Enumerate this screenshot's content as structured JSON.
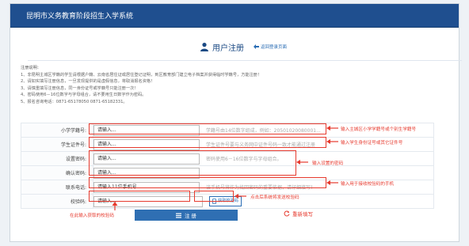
{
  "header": {
    "title": "昆明市义务教育阶段招生入学系统"
  },
  "register": {
    "title": "用户注册",
    "back_link": "返回登录页面"
  },
  "notes": {
    "heading": "注册说明：",
    "lines": [
      "1、非昆明主城区学籍的学生请根据户籍、云南省居住证或居住登记证明，到区教育部门建立电子档案并获得临时学籍号，方能注册！",
      "2、请如实填写注册信息，一旦发现提供的是虚假信息，将取消报名资格！",
      "3、请慎重填写注册信息，同一身份证号或学籍号只能注册一次！",
      "4、密码使用6－16位数字与字母组合，请不要用生日数字作为密码。",
      "5、报名咨询电话：0871-65178050 0871-65182331。"
    ]
  },
  "form": {
    "rows": [
      {
        "label": "小学学籍号:",
        "value": "请输入...",
        "hint": "学籍号由14位数字组成，例如：20501020080001..."
      },
      {
        "label": "学生证件号:",
        "value": "请输入...",
        "hint": "学生证件号要与义务网中证件号码一致才能通过注册"
      },
      {
        "label": "设置密码:",
        "value": "请输入...",
        "hint": "密码使用6－16位数字与字母组合。"
      },
      {
        "label": "确认密码:",
        "value": "请输入...",
        "hint": ""
      },
      {
        "label": "联系电话:",
        "value": "请输入11位手机号...",
        "hint": "该手机号将作为找回密码的重要依据，请仔细填写！"
      },
      {
        "label": "校验码:",
        "value": "请输入...",
        "hint": ""
      }
    ],
    "get_code": "获取校验码"
  },
  "annotations": {
    "a1": "输入主城区小学学籍号或个别生学籍号",
    "a2": "输入学生身份证号或其它证件号",
    "a3": "输入设置的密码",
    "a4": "输入用于接收校验码的手机",
    "a5": "点击后系统将发送校验码",
    "a6": "在此输入获取的校验码"
  },
  "buttons": {
    "register": "注 册",
    "reset": "重新填写"
  },
  "colors": {
    "header": "#1f4f8f",
    "accent": "#2a6db4",
    "annotation": "#e63a2e"
  }
}
